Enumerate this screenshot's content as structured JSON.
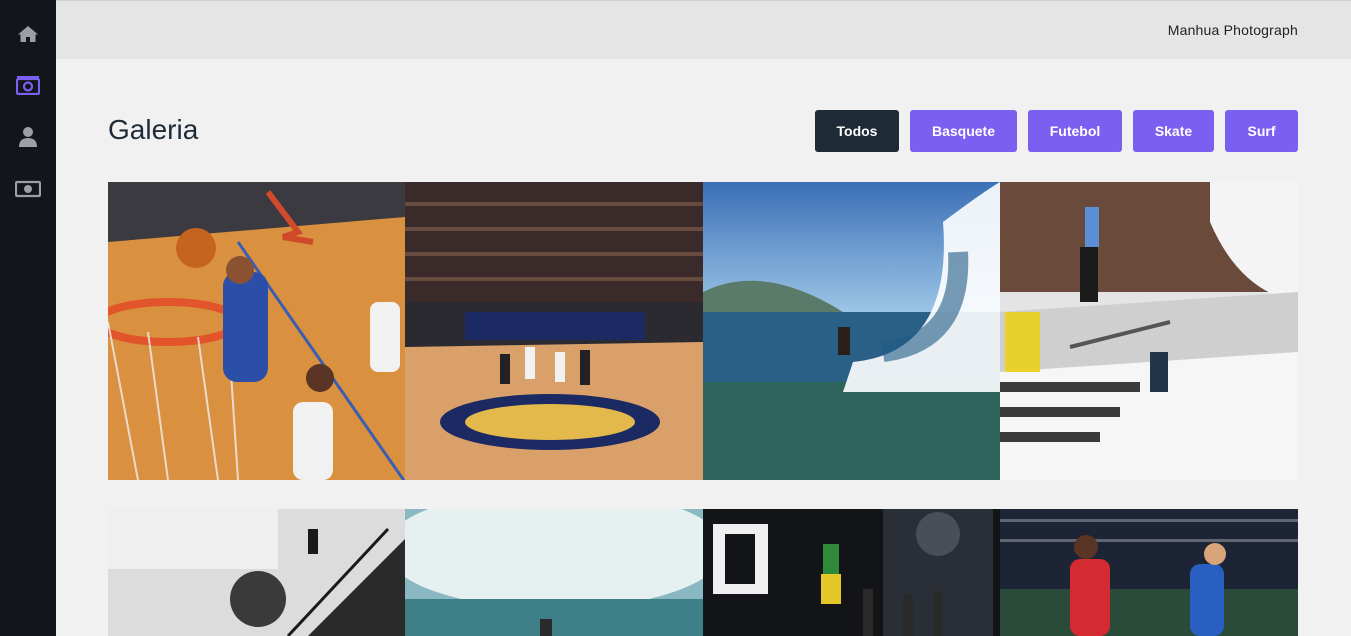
{
  "header": {
    "brand": "Manhua Photograph"
  },
  "sidebar": {
    "items": [
      {
        "icon": "home-icon"
      },
      {
        "icon": "camera-icon"
      },
      {
        "icon": "user-icon"
      },
      {
        "icon": "money-icon"
      }
    ]
  },
  "gallery": {
    "title": "Galeria",
    "filters": [
      "Todos",
      "Basquete",
      "Futebol",
      "Skate",
      "Surf"
    ],
    "active_filter": "Todos",
    "photos": [
      {
        "subject": "basketball-dunk"
      },
      {
        "subject": "basketball-allstar-court"
      },
      {
        "subject": "surf-wave"
      },
      {
        "subject": "skate-rail"
      },
      {
        "subject": "skate-stairs-bw"
      },
      {
        "subject": "surf-spray"
      },
      {
        "subject": "skate-sls-event"
      },
      {
        "subject": "soccer-match"
      }
    ]
  },
  "colors": {
    "accent": "#7b5ff0",
    "active": "#1e2a36",
    "sidebar": "#12161a"
  }
}
